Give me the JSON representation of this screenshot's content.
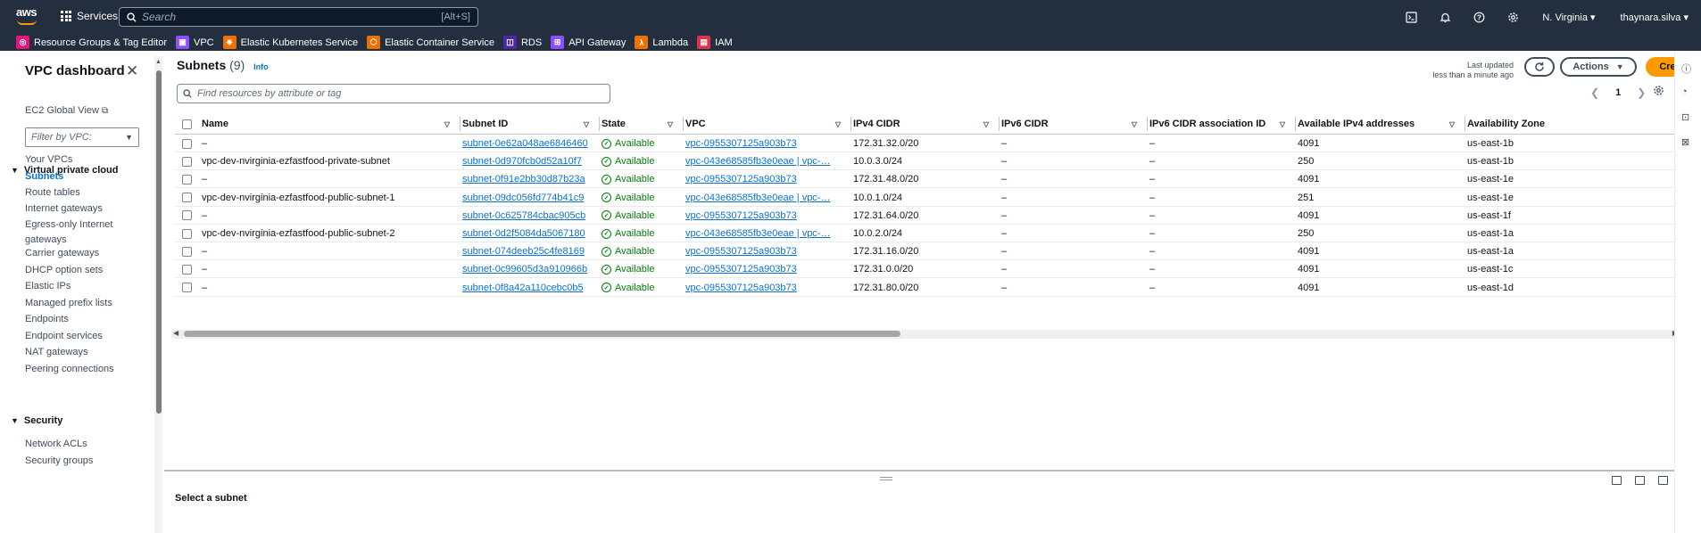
{
  "topbar": {
    "logo_text": "aws",
    "services_label": "Services",
    "search_placeholder": "Search",
    "search_shortcut": "[Alt+S]",
    "region": "N. Virginia",
    "user": "thaynara.silva"
  },
  "favorites": [
    {
      "label": "Resource Groups & Tag Editor",
      "color": "#e7157b"
    },
    {
      "label": "VPC",
      "color": "#8c4fff"
    },
    {
      "label": "Elastic Kubernetes Service",
      "color": "#ed7100"
    },
    {
      "label": "Elastic Container Service",
      "color": "#ed7100"
    },
    {
      "label": "RDS",
      "color": "#4d27aa"
    },
    {
      "label": "API Gateway",
      "color": "#8c4fff"
    },
    {
      "label": "Lambda",
      "color": "#ed7100"
    },
    {
      "label": "IAM",
      "color": "#dd344c"
    }
  ],
  "sidebar": {
    "title": "VPC dashboard",
    "ec2_global_view": "EC2 Global View",
    "filter_placeholder": "Filter by VPC:",
    "section_vpc": "Virtual private cloud",
    "items": [
      "Your VPCs",
      "Subnets",
      "Route tables",
      "Internet gateways",
      "Egress-only Internet gateways",
      "Carrier gateways",
      "DHCP option sets",
      "Elastic IPs",
      "Managed prefix lists",
      "Endpoints",
      "Endpoint services",
      "NAT gateways",
      "Peering connections"
    ],
    "section_security": "Security",
    "security_items": [
      "Network ACLs",
      "Security groups"
    ]
  },
  "panel": {
    "title": "Subnets",
    "count": "(9)",
    "info": "Info",
    "last_updated_1": "Last updated",
    "last_updated_2": "less than a minute ago",
    "actions": "Actions",
    "create": "Create subnet",
    "find_placeholder": "Find resources by attribute or tag",
    "page": "1"
  },
  "columns": [
    "Name",
    "Subnet ID",
    "State",
    "VPC",
    "IPv4 CIDR",
    "IPv6 CIDR",
    "IPv6 CIDR association ID",
    "Available IPv4 addresses",
    "Availability Zone"
  ],
  "rows": [
    {
      "name": "–",
      "subnet_id": "subnet-0e62a048ae6846460",
      "state": "Available",
      "vpc": "vpc-0955307125a903b73",
      "ipv4": "172.31.32.0/20",
      "ipv6": "–",
      "ipv6_assoc": "–",
      "available": "4091",
      "az": "us-east-1b"
    },
    {
      "name": "vpc-dev-nvirginia-ezfastfood-private-subnet",
      "subnet_id": "subnet-0d970fcb0d52a10f7",
      "state": "Available",
      "vpc": "vpc-043e68585fb3e0eae | vpc-…",
      "ipv4": "10.0.3.0/24",
      "ipv6": "–",
      "ipv6_assoc": "–",
      "available": "250",
      "az": "us-east-1b"
    },
    {
      "name": "–",
      "subnet_id": "subnet-0f91e2bb30d87b23a",
      "state": "Available",
      "vpc": "vpc-0955307125a903b73",
      "ipv4": "172.31.48.0/20",
      "ipv6": "–",
      "ipv6_assoc": "–",
      "available": "4091",
      "az": "us-east-1e"
    },
    {
      "name": "vpc-dev-nvirginia-ezfastfood-public-subnet-1",
      "subnet_id": "subnet-09dc056fd774b41c9",
      "state": "Available",
      "vpc": "vpc-043e68585fb3e0eae | vpc-…",
      "ipv4": "10.0.1.0/24",
      "ipv6": "–",
      "ipv6_assoc": "–",
      "available": "251",
      "az": "us-east-1e"
    },
    {
      "name": "–",
      "subnet_id": "subnet-0c625784cbac905cb",
      "state": "Available",
      "vpc": "vpc-0955307125a903b73",
      "ipv4": "172.31.64.0/20",
      "ipv6": "–",
      "ipv6_assoc": "–",
      "available": "4091",
      "az": "us-east-1f"
    },
    {
      "name": "vpc-dev-nvirginia-ezfastfood-public-subnet-2",
      "subnet_id": "subnet-0d2f5084da5067180",
      "state": "Available",
      "vpc": "vpc-043e68585fb3e0eae | vpc-…",
      "ipv4": "10.0.2.0/24",
      "ipv6": "–",
      "ipv6_assoc": "–",
      "available": "250",
      "az": "us-east-1a"
    },
    {
      "name": "–",
      "subnet_id": "subnet-074deeb25c4fe8169",
      "state": "Available",
      "vpc": "vpc-0955307125a903b73",
      "ipv4": "172.31.16.0/20",
      "ipv6": "–",
      "ipv6_assoc": "–",
      "available": "4091",
      "az": "us-east-1a"
    },
    {
      "name": "–",
      "subnet_id": "subnet-0c99605d3a910966b",
      "state": "Available",
      "vpc": "vpc-0955307125a903b73",
      "ipv4": "172.31.0.0/20",
      "ipv6": "–",
      "ipv6_assoc": "–",
      "available": "4091",
      "az": "us-east-1c"
    },
    {
      "name": "–",
      "subnet_id": "subnet-0f8a42a110cebc0b5",
      "state": "Available",
      "vpc": "vpc-0955307125a903b73",
      "ipv4": "172.31.80.0/20",
      "ipv6": "–",
      "ipv6_assoc": "–",
      "available": "4091",
      "az": "us-east-1d"
    }
  ],
  "split_panel": {
    "label": "Select a subnet"
  }
}
